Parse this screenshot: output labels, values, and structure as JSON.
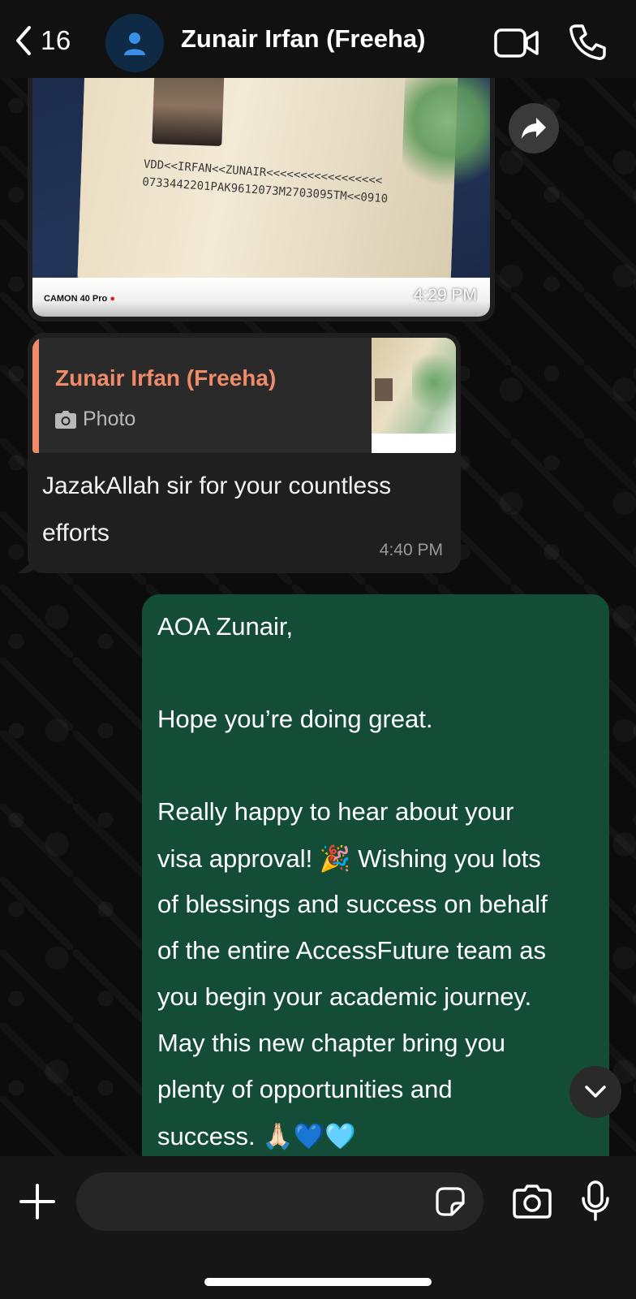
{
  "header": {
    "back_count": "16",
    "contact_name": "Zunair Irfan (Freeha)",
    "icons": [
      "chevron-left-icon",
      "user-avatar-icon",
      "video-camera-icon",
      "phone-icon"
    ]
  },
  "messages": [
    {
      "type": "image",
      "direction": "incoming",
      "camera_label": "CAMON 40 Pro",
      "mrz_line_1": "VDD<<IRFAN<<ZUNAIR<<<<<<<<<<<<<<<<<",
      "mrz_line_2": "0733442201PAK9612073M2703095TM<<0910",
      "time": "4:29 PM"
    },
    {
      "type": "reply",
      "direction": "incoming",
      "quoted_name": "Zunair Irfan (Freeha)",
      "quoted_kind": "Photo",
      "text": "JazakAllah sir for your countless efforts",
      "time": "4:40 PM"
    },
    {
      "type": "text",
      "direction": "outgoing",
      "lines": [
        "AOA Zunair,",
        "",
        "Hope you’re doing great.",
        "",
        "Really happy to hear about your",
        "visa approval! 🎉 Wishing you lots",
        "of blessings and success on behalf",
        "of the entire AccessFuture team as",
        "you begin your academic journey.",
        "May this new chapter bring you",
        "plenty of opportunities and",
        "success. 🙏🏻💙🩵"
      ]
    }
  ],
  "composer": {
    "placeholder": ""
  },
  "colors": {
    "incoming_bubble": "#1f1f1f",
    "outgoing_bubble": "#134d37",
    "quote_accent": "#f08b6a",
    "header_bg": "#111111"
  }
}
